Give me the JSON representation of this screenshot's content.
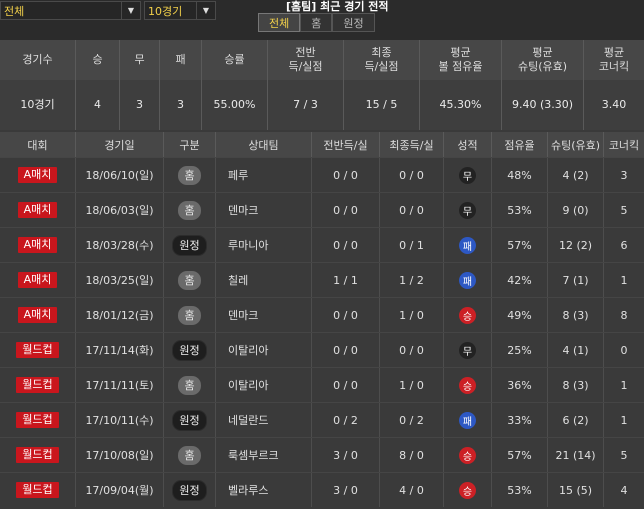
{
  "filters": {
    "scope": "전체",
    "games": "10경기"
  },
  "title": "[홈팀] 최근 경기 전적",
  "tabs": [
    "전체",
    "홈",
    "원정"
  ],
  "summary": {
    "headers": [
      "경기수",
      "승",
      "무",
      "패",
      "승률",
      "전반\n득/실점",
      "최종\n득/실점",
      "평균\n볼 점유율",
      "평균\n슈팅(유효)",
      "평균\n코너킥"
    ],
    "values": [
      "10경기",
      "4",
      "3",
      "3",
      "55.00%",
      "7 / 3",
      "15 / 5",
      "45.30%",
      "9.40 (3.30)",
      "3.40"
    ]
  },
  "table": {
    "headers": [
      "대회",
      "경기일",
      "구분",
      "상대팀",
      "전반득/실",
      "최종득/실",
      "성적",
      "점유율",
      "슈팅(유효)",
      "코너킥"
    ],
    "rows": [
      {
        "comp": "A매치",
        "date": "18/06/10(일)",
        "div": "홈",
        "div_type": "home",
        "opp": "페루",
        "half": "0 / 0",
        "final": "0 / 0",
        "res": "무",
        "res_type": "draw",
        "poss": "48%",
        "shots": "4 (2)",
        "corner": "3"
      },
      {
        "comp": "A매치",
        "date": "18/06/03(일)",
        "div": "홈",
        "div_type": "home",
        "opp": "덴마크",
        "half": "0 / 0",
        "final": "0 / 0",
        "res": "무",
        "res_type": "draw",
        "poss": "53%",
        "shots": "9 (0)",
        "corner": "5"
      },
      {
        "comp": "A매치",
        "date": "18/03/28(수)",
        "div": "원정",
        "div_type": "away",
        "opp": "루마니아",
        "half": "0 / 0",
        "final": "0 / 1",
        "res": "패",
        "res_type": "loss",
        "poss": "57%",
        "shots": "12 (2)",
        "corner": "6"
      },
      {
        "comp": "A매치",
        "date": "18/03/25(일)",
        "div": "홈",
        "div_type": "home",
        "opp": "칠레",
        "half": "1 / 1",
        "final": "1 / 2",
        "res": "패",
        "res_type": "loss",
        "poss": "42%",
        "shots": "7 (1)",
        "corner": "1"
      },
      {
        "comp": "A매치",
        "date": "18/01/12(금)",
        "div": "홈",
        "div_type": "home",
        "opp": "덴마크",
        "half": "0 / 0",
        "final": "1 / 0",
        "res": "승",
        "res_type": "win",
        "poss": "49%",
        "shots": "8 (3)",
        "corner": "8"
      },
      {
        "comp": "월드컵",
        "date": "17/11/14(화)",
        "div": "원정",
        "div_type": "away",
        "opp": "이탈리아",
        "half": "0 / 0",
        "final": "0 / 0",
        "res": "무",
        "res_type": "draw",
        "poss": "25%",
        "shots": "4 (1)",
        "corner": "0"
      },
      {
        "comp": "월드컵",
        "date": "17/11/11(토)",
        "div": "홈",
        "div_type": "home",
        "opp": "이탈리아",
        "half": "0 / 0",
        "final": "1 / 0",
        "res": "승",
        "res_type": "win",
        "poss": "36%",
        "shots": "8 (3)",
        "corner": "1"
      },
      {
        "comp": "월드컵",
        "date": "17/10/11(수)",
        "div": "원정",
        "div_type": "away",
        "opp": "네덜란드",
        "half": "0 / 2",
        "final": "0 / 2",
        "res": "패",
        "res_type": "loss",
        "poss": "33%",
        "shots": "6 (2)",
        "corner": "1"
      },
      {
        "comp": "월드컵",
        "date": "17/10/08(일)",
        "div": "홈",
        "div_type": "home",
        "opp": "룩셈부르크",
        "half": "3 / 0",
        "final": "8 / 0",
        "res": "승",
        "res_type": "win",
        "poss": "57%",
        "shots": "21 (14)",
        "corner": "5"
      },
      {
        "comp": "월드컵",
        "date": "17/09/04(월)",
        "div": "원정",
        "div_type": "away",
        "opp": "벨라루스",
        "half": "3 / 0",
        "final": "4 / 0",
        "res": "승",
        "res_type": "win",
        "poss": "53%",
        "shots": "15 (5)",
        "corner": "4"
      }
    ]
  },
  "colors": {
    "comp_badge": "#c9161d",
    "win": "#cc2025",
    "loss": "#2d58c4",
    "draw": "#222222",
    "accent": "#f2d04a"
  }
}
